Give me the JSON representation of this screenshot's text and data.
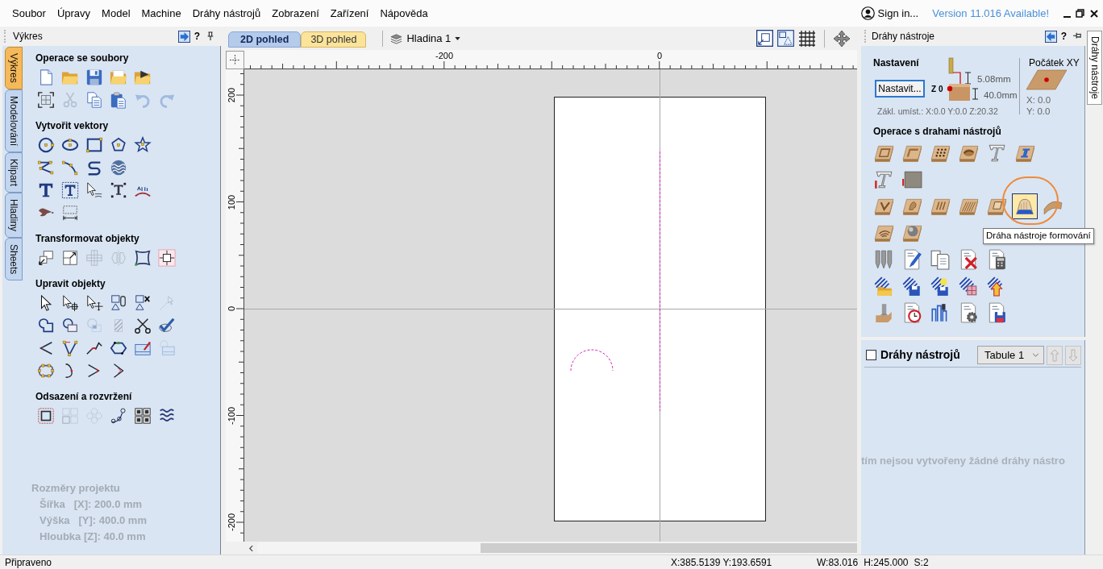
{
  "menu_bar": {
    "items": [
      "Soubor",
      "Úpravy",
      "Model",
      "Machine",
      "Dráhy nástrojů",
      "Zobrazení",
      "Zařízení",
      "Nápověda"
    ],
    "sign_in": "Sign in...",
    "update_notice": "Version 11.016 Available!"
  },
  "drawing_panel": {
    "title": "Výkres",
    "help": "?",
    "side_tabs": [
      {
        "label": "Výkres",
        "selected": true
      },
      {
        "label": "Modelování",
        "selected": false
      },
      {
        "label": "Klipart",
        "selected": false
      },
      {
        "label": "Hladiny",
        "selected": false
      },
      {
        "label": "Sheets",
        "selected": false
      }
    ],
    "groups": [
      {
        "title": "Operace se soubory",
        "rows": [
          [
            {
              "kind": "new",
              "disabled": false
            },
            {
              "kind": "open",
              "disabled": false
            },
            {
              "kind": "save",
              "disabled": false
            },
            {
              "kind": "open-recent",
              "disabled": false
            },
            {
              "kind": "import",
              "disabled": false
            }
          ],
          [
            {
              "kind": "select-all",
              "disabled": false
            },
            {
              "kind": "cut",
              "disabled": true
            },
            {
              "kind": "copy",
              "disabled": false
            },
            {
              "kind": "paste",
              "disabled": false
            },
            {
              "kind": "undo",
              "disabled": true
            },
            {
              "kind": "redo",
              "disabled": true
            }
          ]
        ]
      },
      {
        "title": "Vytvořit vektory",
        "rows": [
          [
            {
              "kind": "circle",
              "disabled": false
            },
            {
              "kind": "ellipse",
              "disabled": false
            },
            {
              "kind": "rectangle",
              "disabled": false
            },
            {
              "kind": "polygon",
              "disabled": false
            },
            {
              "kind": "star",
              "disabled": false
            }
          ],
          [
            {
              "kind": "polyline",
              "disabled": false
            },
            {
              "kind": "arc",
              "disabled": false
            },
            {
              "kind": "s-curve",
              "disabled": false
            },
            {
              "kind": "waves",
              "disabled": false
            }
          ],
          [
            {
              "kind": "text",
              "disabled": false
            },
            {
              "kind": "text-box",
              "disabled": false
            },
            {
              "kind": "text-cursor",
              "disabled": false
            },
            {
              "kind": "text-stretch",
              "disabled": false
            },
            {
              "kind": "text-arc",
              "disabled": false
            }
          ],
          [
            {
              "kind": "bird",
              "disabled": false
            },
            {
              "kind": "dimension",
              "disabled": false
            }
          ]
        ]
      },
      {
        "title": "Transformovat objekty",
        "rows": [
          [
            {
              "kind": "move",
              "disabled": false
            },
            {
              "kind": "scale",
              "disabled": false
            },
            {
              "kind": "align",
              "disabled": true
            },
            {
              "kind": "mirror",
              "disabled": true
            },
            {
              "kind": "distort",
              "disabled": false
            },
            {
              "kind": "fit",
              "disabled": false
            }
          ]
        ]
      },
      {
        "title": "Upravit objekty",
        "rows": [
          [
            {
              "kind": "select",
              "disabled": false
            },
            {
              "kind": "node-edit",
              "disabled": false
            },
            {
              "kind": "transform",
              "disabled": false
            },
            {
              "kind": "group",
              "disabled": false
            },
            {
              "kind": "ungroup",
              "disabled": false
            },
            {
              "kind": "measure",
              "disabled": true
            }
          ],
          [
            {
              "kind": "weld",
              "disabled": false
            },
            {
              "kind": "merge",
              "disabled": false
            },
            {
              "kind": "subtract",
              "disabled": true
            },
            {
              "kind": "intersect",
              "disabled": true
            },
            {
              "kind": "trim",
              "disabled": false
            },
            {
              "kind": "check",
              "disabled": false
            }
          ],
          [
            {
              "kind": "fillet",
              "disabled": false
            },
            {
              "kind": "polyline-nodes",
              "disabled": false
            },
            {
              "kind": "smooth",
              "disabled": false
            },
            {
              "kind": "closed-nodes",
              "disabled": false
            },
            {
              "kind": "image-pen",
              "disabled": false
            },
            {
              "kind": "image",
              "disabled": true
            }
          ],
          [
            {
              "kind": "node-loop",
              "disabled": false
            },
            {
              "kind": "join-open",
              "disabled": false
            },
            {
              "kind": "join-curve",
              "disabled": false
            },
            {
              "kind": "extend",
              "disabled": false
            }
          ]
        ]
      },
      {
        "title": "Odsazení a rozvržení",
        "rows": [
          [
            {
              "kind": "offset",
              "disabled": false
            },
            {
              "kind": "grid-array",
              "disabled": true
            },
            {
              "kind": "circle-array",
              "disabled": true
            },
            {
              "kind": "path-copy",
              "disabled": false
            },
            {
              "kind": "nesting",
              "disabled": false
            },
            {
              "kind": "text-wrap",
              "disabled": false
            }
          ]
        ]
      }
    ],
    "project_size": {
      "title": "Rozměry projektu",
      "lines": [
        "Šířka   [X]: 200.0 mm",
        "Výška   [Y]: 400.0 mm",
        "Hloubka [Z]: 40.0 mm"
      ]
    }
  },
  "view": {
    "tabs": [
      {
        "label": "2D pohled",
        "selected": true
      },
      {
        "label": "3D pohled",
        "selected": false
      }
    ],
    "layer": "Hladina 1",
    "horizontal_ruler": [
      "-200",
      "0"
    ],
    "vertical_ruler": [
      "200",
      "100",
      "0",
      "-100",
      "-200"
    ]
  },
  "toolpaths_panel": {
    "title": "Dráhy nástroje",
    "help": "?",
    "side_tab": {
      "label": "Dráhy nástroje",
      "selected": true
    },
    "setup": {
      "title": "Nastavení",
      "button": "Nastavit...",
      "z_zero": "Z 0",
      "safe_height": "5.08mm",
      "material_thickness": "40.0mm",
      "home_position": "Zákl. umíst.: X:0.0 Y:0.0 Z:20.32"
    },
    "origin": {
      "title": "Počátek XY",
      "x": "X: 0.0",
      "y": "Y: 0.0"
    },
    "operations": {
      "title": "Operace s drahami nástrojů",
      "hover_circle": true,
      "tooltip": "Dráha nástroje formování",
      "rows": [
        [
          {
            "kind": "profile",
            "highlighted": false
          },
          {
            "kind": "pocket",
            "highlighted": false
          },
          {
            "kind": "drill",
            "highlighted": false
          },
          {
            "kind": "recess",
            "highlighted": false
          },
          {
            "kind": "engrave",
            "highlighted": false
          },
          {
            "kind": "inlay",
            "highlighted": false
          }
        ],
        [
          {
            "kind": "text-3d",
            "highlighted": false
          },
          {
            "kind": "photo",
            "highlighted": false
          }
        ],
        [
          {
            "kind": "vcarve",
            "highlighted": false
          },
          {
            "kind": "relief",
            "highlighted": false
          },
          {
            "kind": "fluting",
            "highlighted": false
          },
          {
            "kind": "texture",
            "highlighted": false
          },
          {
            "kind": "prism",
            "highlighted": false
          },
          {
            "kind": "moulding",
            "highlighted": true
          },
          {
            "kind": "rotary",
            "highlighted": false
          }
        ],
        [
          {
            "kind": "rings",
            "highlighted": false
          },
          {
            "kind": "sphere",
            "highlighted": false
          }
        ],
        [
          {
            "kind": "tool-db",
            "highlighted": false
          },
          {
            "kind": "edit-gcode",
            "highlighted": false
          },
          {
            "kind": "merge-gcode",
            "highlighted": false
          },
          {
            "kind": "delete-gcode",
            "highlighted": false
          },
          {
            "kind": "calc-gcode",
            "highlighted": false
          }
        ],
        [
          {
            "kind": "stack-folder",
            "highlighted": false
          },
          {
            "kind": "stack-save",
            "highlighted": false
          },
          {
            "kind": "stack-bulb",
            "highlighted": false
          },
          {
            "kind": "stack-grid",
            "highlighted": false
          },
          {
            "kind": "stack-arrow",
            "highlighted": false
          }
        ],
        [
          {
            "kind": "tool-block",
            "highlighted": false
          },
          {
            "kind": "doc-clock",
            "highlighted": false
          },
          {
            "kind": "template",
            "highlighted": false
          },
          {
            "kind": "doc-gear",
            "highlighted": false
          },
          {
            "kind": "doc-save",
            "highlighted": false
          }
        ]
      ]
    },
    "list": {
      "checkbox": {
        "label": "Dráhy nástrojů",
        "checked": false
      },
      "sheet": "Tabule 1",
      "move_up": {
        "disabled": true
      },
      "move_down": {
        "disabled": true
      },
      "empty_message": "tím nejsou vytvořeny žádné dráhy nástro"
    }
  },
  "status_bar": {
    "message": "Připraveno",
    "cursor": "X:385.5139 Y:193.6591",
    "readouts": [
      "W:83.016",
      "H:245.000",
      "S:2"
    ]
  }
}
